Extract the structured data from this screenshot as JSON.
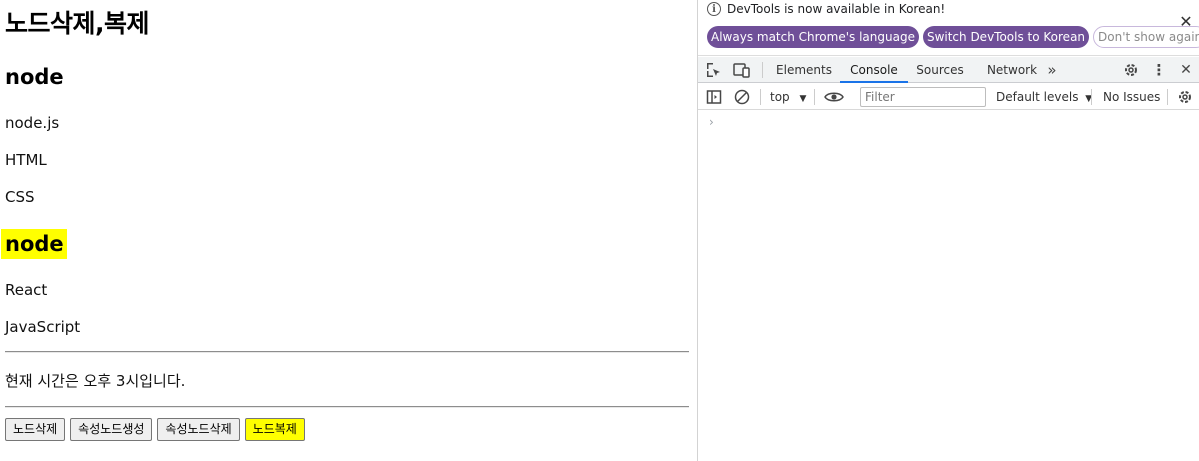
{
  "page": {
    "title": "노드삭제,복제",
    "heading1": "node",
    "items1": [
      "node.js",
      "HTML",
      "CSS"
    ],
    "heading2": "node",
    "items2": [
      "React",
      "JavaScript"
    ],
    "time_text": "현재 시간은 오후 3시입니다.",
    "buttons": {
      "delete_node": "노드삭제",
      "create_attr_node": "속성노드생성",
      "delete_attr_node": "속성노드삭제",
      "clone_node": "노드복제"
    },
    "highlight_color": "#ffff00"
  },
  "devtools": {
    "info_text": "DevTools is now available in Korean!",
    "pills": {
      "match_language": "Always match Chrome's language",
      "switch_korean": "Switch DevTools to Korean",
      "dont_show": "Don't show again"
    },
    "tabs": [
      "Elements",
      "Console",
      "Sources",
      "Network"
    ],
    "active_tab": "Console",
    "context": "top",
    "filter_placeholder": "Filter",
    "levels": "Default levels",
    "issues": "No Issues",
    "prompt": "›",
    "accent_color": "#6f4f98"
  }
}
